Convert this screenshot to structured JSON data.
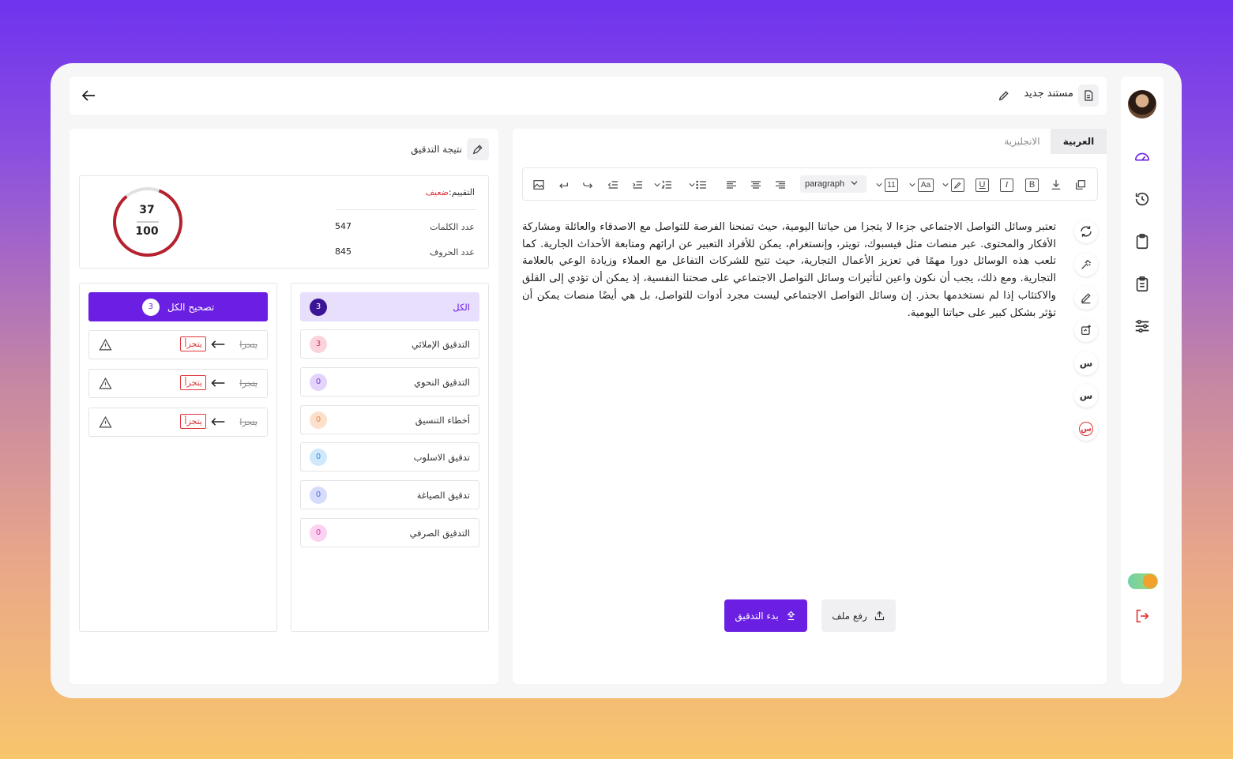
{
  "app": {
    "doc_title": "مستند جديد"
  },
  "editor": {
    "tabs": [
      {
        "label": "العربية",
        "active": true
      },
      {
        "label": "الانجليزية",
        "active": false
      }
    ],
    "toolbar": {
      "paragraph_label": "paragraph",
      "font_size": "11",
      "font_case": "Aa",
      "bold": "B",
      "italic": "I",
      "underline": "U"
    },
    "text": "تعتبر وسائل التواصل الاجتماعي جزءا لا يتجزا من حياتنا اليومية، حيث تمنحنا الفرصة للتواصل مع الاصدقاء والعائلة ومشاركة الأفكار والمحتوى. عبر منصات مثل فيسبوك، تويتر، وإنستغرام، يمكن للأفراد التعبير عن ارائهم ومتابعة الأحداث الجارية. كما تلعب هذه الوسائل دورا مهمًا في تعزيز الأعمال التجارية، حيث تتيح للشركات التفاعل مع العملاء وزيادة الوعي بالعلامة التجارية. ومع ذلك، يجب أن نكون واعين لتأثيرات وسائل التواصل الاجتماعي على صحتنا النفسية، إذ يمكن أن تؤدي إلى القلق والاكتئاب إذا لم نستخدمها بحذر. إن وسائل التواصل الاجتماعي ليست مجرد أدوات للتواصل، بل هي أيضًا منصات يمكن أن تؤثر بشكل كبير على حياتنا اليومية.",
    "side_tools": [
      "refresh-icon",
      "magic-icon",
      "pen-icon",
      "ai-edit-icon",
      "letter-s-icon",
      "letter-s2-icon",
      "letter-s3-icon"
    ],
    "side_letters": [
      "س",
      "س",
      "س"
    ],
    "upload_label": "رفع ملف",
    "start_label": "بدء التدقيق"
  },
  "results": {
    "title": "نتيجة التدقيق",
    "rating_label": "التقييم:",
    "rating_value": "ضعيف",
    "stats": [
      {
        "label": "عدد الكلمات",
        "value": "547"
      },
      {
        "label": "عدد الحروف",
        "value": "845"
      }
    ],
    "score": {
      "value": "37",
      "max": "100",
      "fraction": 0.37
    },
    "categories": [
      {
        "label": "الكل",
        "count": "3",
        "bg": "#3b1596",
        "fg": "#ffffff",
        "active": true
      },
      {
        "label": "التدقيق الإملائي",
        "count": "3",
        "bg": "#fbd3dc",
        "fg": "#e0356a"
      },
      {
        "label": "التدقيق النحوي",
        "count": "0",
        "bg": "#e4d4fb",
        "fg": "#7a3fe0"
      },
      {
        "label": "أخطاء التنسيق",
        "count": "0",
        "bg": "#fde0cc",
        "fg": "#e88a4a"
      },
      {
        "label": "تدقيق الاسلوب",
        "count": "0",
        "bg": "#cfe8fb",
        "fg": "#3a8fd9"
      },
      {
        "label": "تدقيق الصياغة",
        "count": "0",
        "bg": "#d6dcfb",
        "fg": "#5a6ee0"
      },
      {
        "label": "التدقيق الصرفي",
        "count": "0",
        "bg": "#fbd3f0",
        "fg": "#d635b0"
      }
    ],
    "fix_all_label": "تصحيح الكل",
    "fix_all_count": "3",
    "corrections": [
      {
        "original": "يتجزا",
        "suggestion": "يتجزأ"
      },
      {
        "original": "يتجزا",
        "suggestion": "يتجزأ"
      },
      {
        "original": "يتجزا",
        "suggestion": "يتجزأ"
      }
    ]
  },
  "colors": {
    "accent": "#6a1fe3",
    "danger": "#e0353b"
  }
}
